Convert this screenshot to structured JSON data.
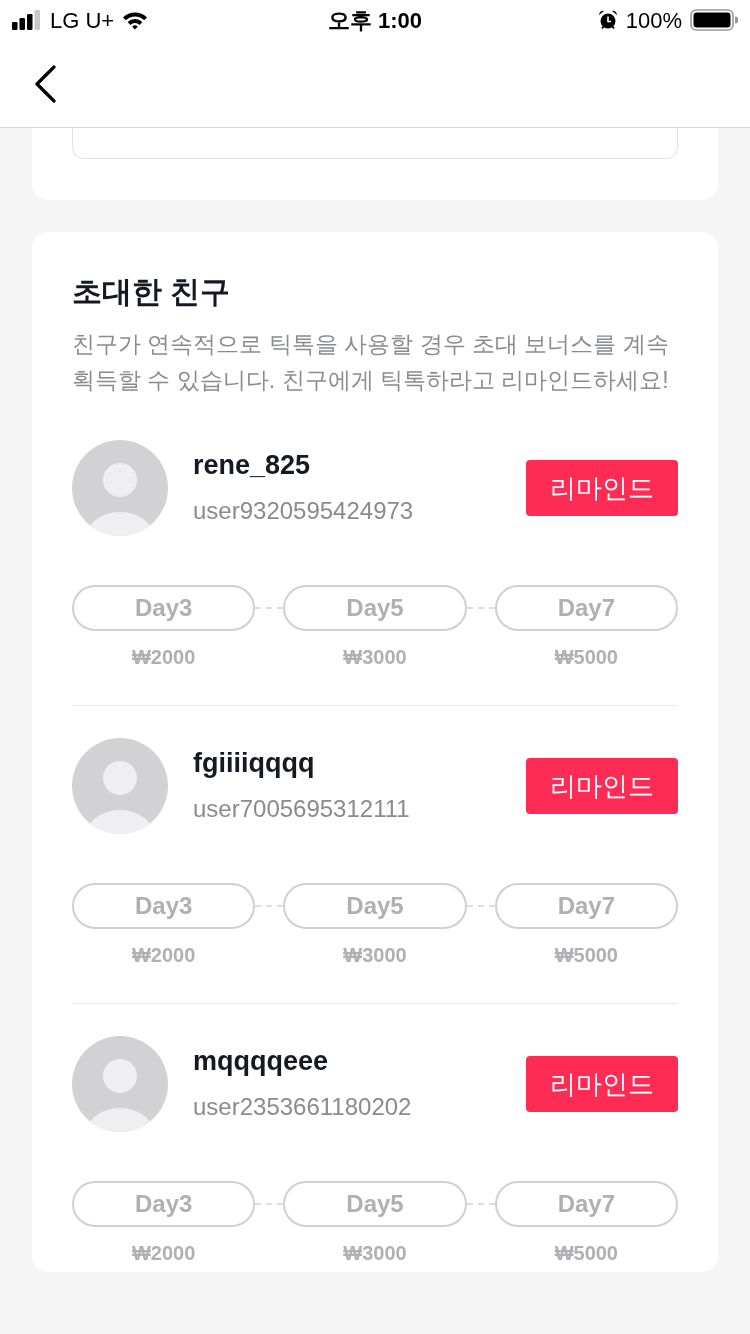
{
  "status_bar": {
    "carrier": "LG U+",
    "time": "오후 1:00",
    "battery": "100%"
  },
  "invited_section": {
    "title": "초대한 친구",
    "description": "친구가 연속적으로 틱톡을 사용할 경우 초대 보너스를 계속 획득할 수 있습니다. 친구에게 틱톡하라고 리마인드하세요!"
  },
  "friends": [
    {
      "name": "rene_825",
      "user_id": "user9320595424973",
      "button": "리마인드",
      "milestones": [
        {
          "day": "Day3",
          "reward": "₩2000"
        },
        {
          "day": "Day5",
          "reward": "₩3000"
        },
        {
          "day": "Day7",
          "reward": "₩5000"
        }
      ]
    },
    {
      "name": "fgiiiiqqqq",
      "user_id": "user7005695312111",
      "button": "리마인드",
      "milestones": [
        {
          "day": "Day3",
          "reward": "₩2000"
        },
        {
          "day": "Day5",
          "reward": "₩3000"
        },
        {
          "day": "Day7",
          "reward": "₩5000"
        }
      ]
    },
    {
      "name": "mqqqqeee",
      "user_id": "user2353661180202",
      "button": "리마인드",
      "milestones": [
        {
          "day": "Day3",
          "reward": "₩2000"
        },
        {
          "day": "Day5",
          "reward": "₩3000"
        },
        {
          "day": "Day7",
          "reward": "₩5000"
        }
      ]
    }
  ]
}
